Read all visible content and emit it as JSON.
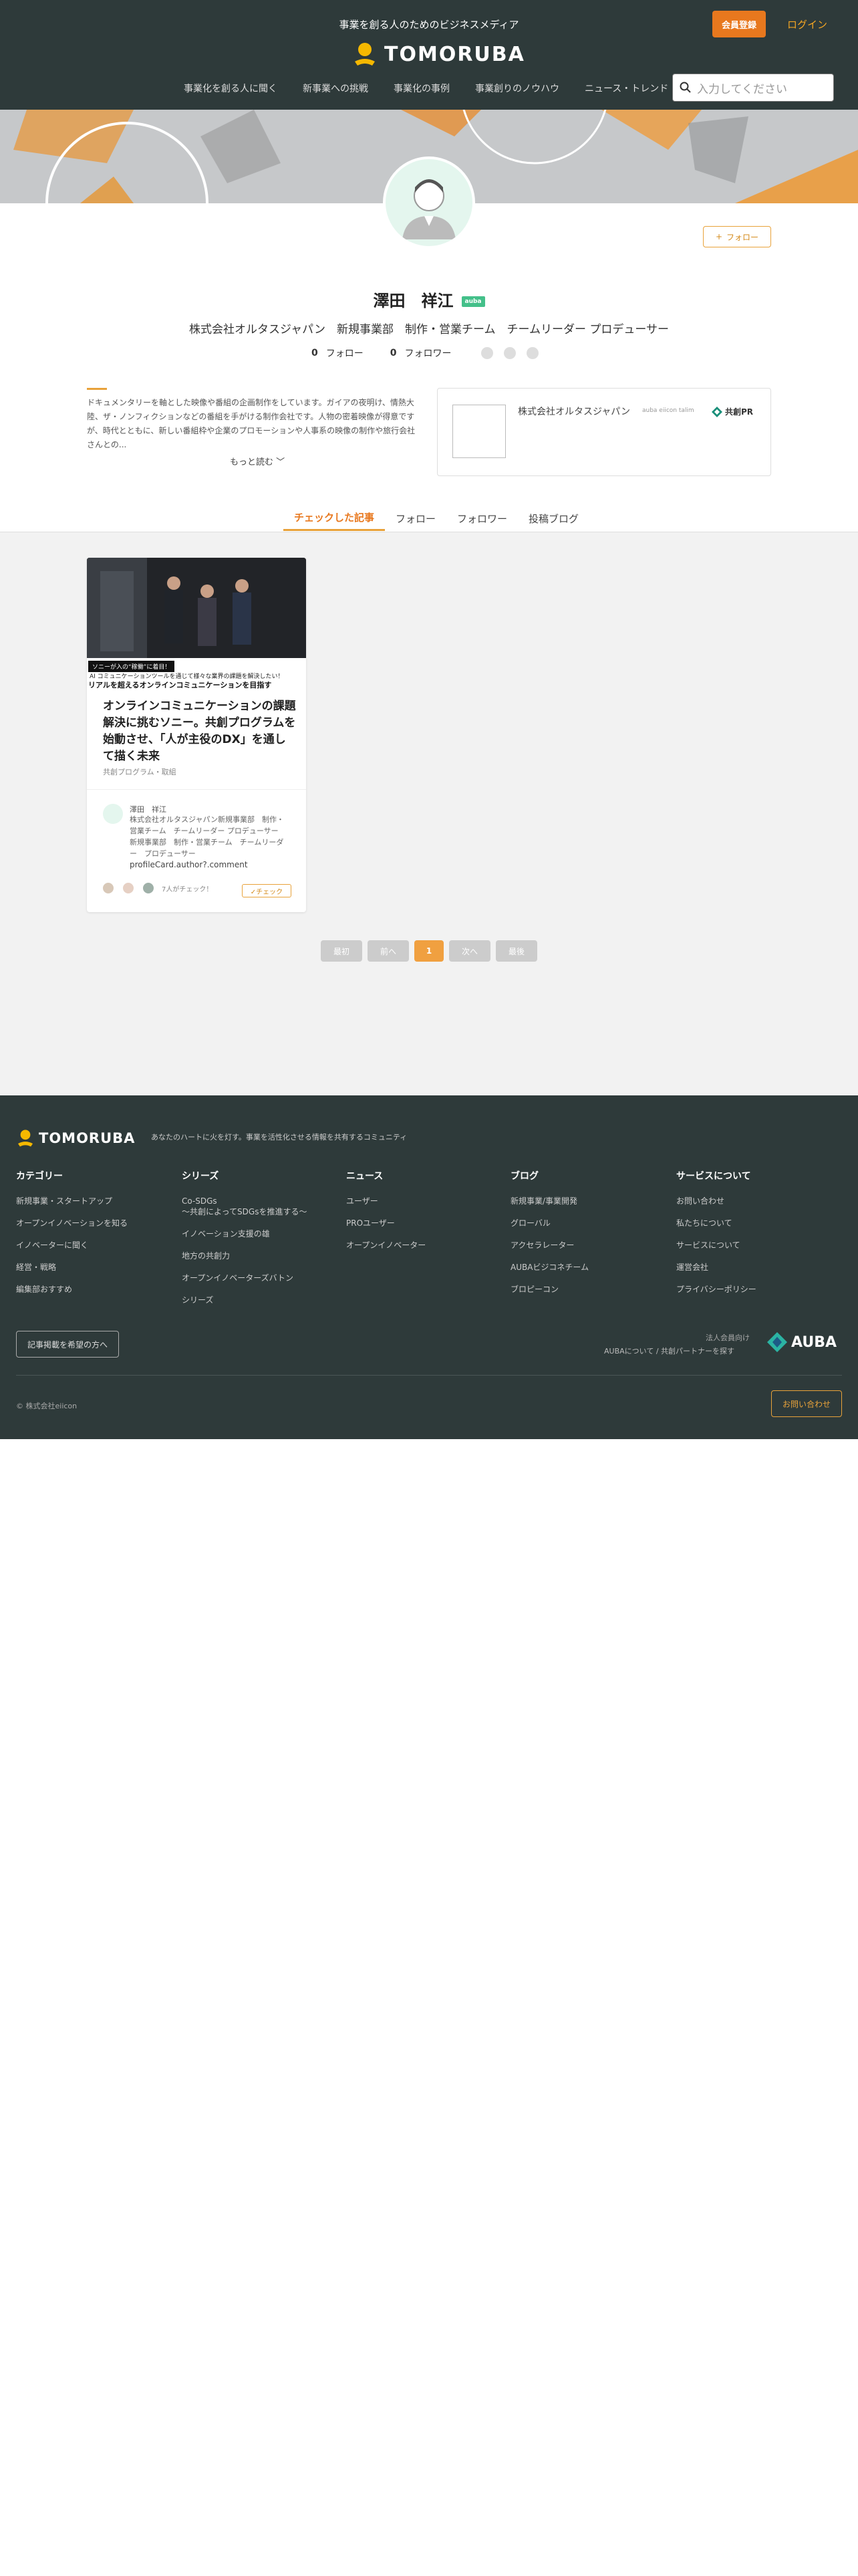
{
  "header": {
    "tagline": "事業を創る人のためのビジネスメディア",
    "logo_text": "TOMORUBA",
    "register_label": "会員登録",
    "login_label": "ログイン",
    "nav": [
      "事業化を創る人に聞く",
      "新事業への挑戦",
      "事業化の事例",
      "事業創りのノウハウ",
      "ニュース・トレンド"
    ],
    "search_placeholder": "入力してください"
  },
  "profile": {
    "follow_label": "フォロー",
    "name": "澤田　祥江",
    "badge": "auba",
    "affiliation": "株式会社オルタスジャパン　新規事業部　制作・営業チーム　チームリーダー プロデューサー",
    "follow_count": "0",
    "follow_text": "フォロー",
    "follower_count": "0",
    "follower_text": "フォロワー",
    "bio": "ドキュメンタリーを軸とした映像や番組の企画制作をしています。ガイアの夜明け、情熱大陸、ザ・ノンフィクションなどの番組を手がける制作会社です。人物の密着映像が得意ですが、時代とともに、新しい番組枠や企業のプロモーションや人事系の映像の制作や旅行会社さんとの...",
    "more_label": "もっと読む"
  },
  "company": {
    "name": "株式会社オルタスジャパン",
    "side_text": "auba eiicon ​talim",
    "pr_label": "共創PR"
  },
  "tabs": [
    "チェックした記事",
    "フォロー",
    "フォロワー",
    "投稿ブログ"
  ],
  "article": {
    "image_tag": "ソニーが入の“稼働”に着目！",
    "image_sub": "AI コミュニケーションツールを通じて様々な業界の課題を解決したい！",
    "image_big": "リアルを超えるオンラインコミュニケーションを目指す",
    "title": "オンラインコミュニケーションの課題解決に挑むソニー。共創プログラムを始動させ、「人が主役のDX」を通して描く未来",
    "category": "共創プログラム・取組",
    "author_name": "澤田　祥江",
    "author_affiliation": "株式会社オルタスジャパン新規事業部　制作・営業チーム　チームリーダー プロデューサー　新規事業部　制作・営業チーム　チームリーダー　プロデューサー",
    "comment": "profileCard.author?.comment",
    "checked_by": "7人がチェック！",
    "check_label": "✓チェック"
  },
  "pager": {
    "first": "最初",
    "prev": "前へ",
    "current": "1",
    "next": "次へ",
    "last": "最後"
  },
  "footer": {
    "logo_text": "TOMORUBA",
    "slogan": "あなたのハートに火を灯す。事業を活性化させる情報を共有するコミュニティ",
    "columns": [
      {
        "title": "カテゴリー",
        "items": [
          "新規事業・スタートアップ",
          "オープンイノベーションを知る",
          "イノベーターに聞く",
          "経営・戦略",
          "編集部おすすめ"
        ]
      },
      {
        "title": "シリーズ",
        "items": [
          "Co-SDGs\n〜共創によってSDGsを推進する〜",
          "イノベーション支援の雄",
          "地方の共創力",
          "オープンイノベーターズバトン",
          "シリーズ"
        ]
      },
      {
        "title": "ニュース",
        "items": [
          "ユーザー",
          "PROユーザー",
          "オープンイノベーター"
        ]
      },
      {
        "title": "ブログ",
        "items": [
          "新規事業/事業開発",
          "グローバル",
          "アクセラレーター",
          "AUBAビジコネチーム",
          "ブロピーコン"
        ]
      },
      {
        "title": "サービスについて",
        "items": [
          "お問い合わせ",
          "私たちについて",
          "サービスについて",
          "運営会社",
          "プライバシーポリシー"
        ]
      }
    ],
    "post_button": "記事掲載を希望の方へ",
    "corp_text": "法人会員向け",
    "about_text": "AUBAについて / 共創パートナーを探す",
    "auba_logo": "AUBA",
    "copyright": "© 株式会社eiicon",
    "contact_label": "お問い合わせ"
  },
  "colors": {
    "header_bg": "#2e3a3a",
    "accent": "#e8781e",
    "accent_light": "#e8a23a",
    "page_bg": "#f2f2f2"
  }
}
